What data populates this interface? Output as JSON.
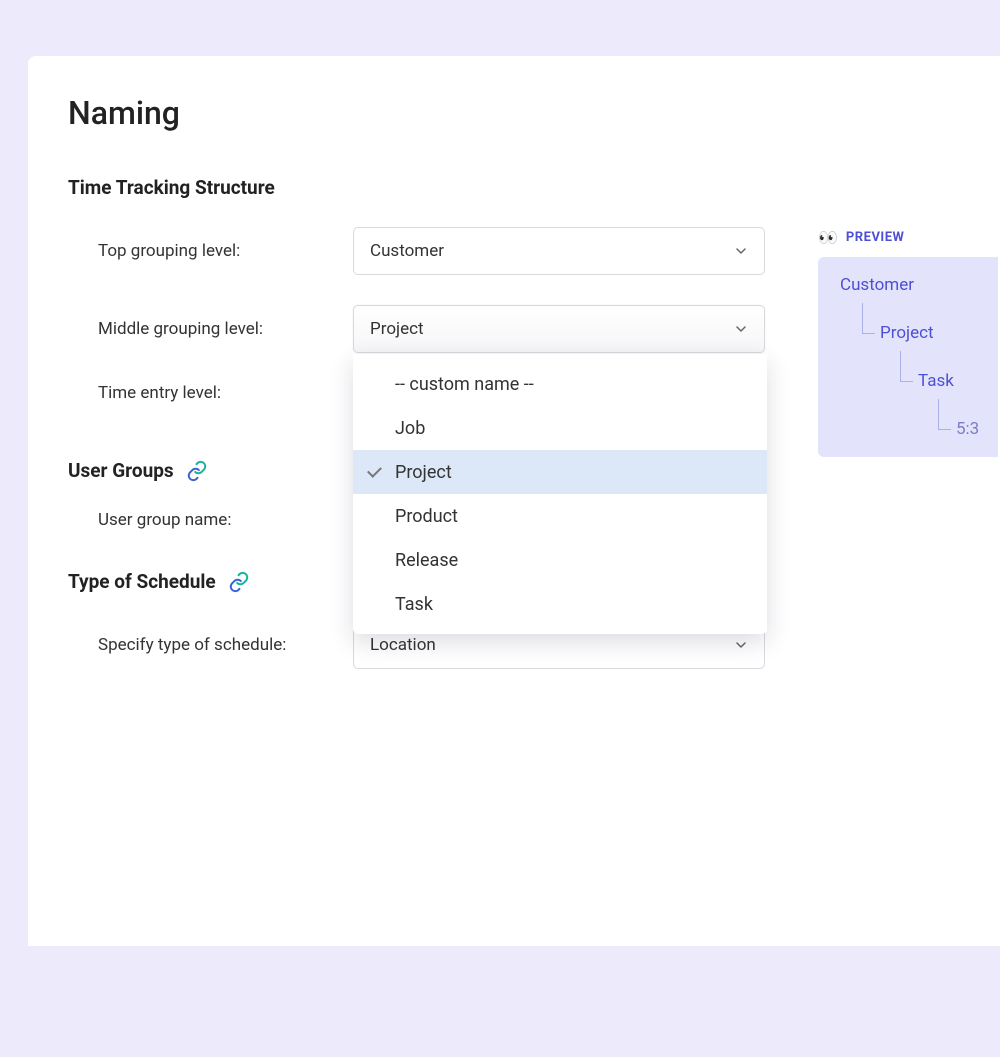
{
  "page": {
    "title": "Naming"
  },
  "sections": {
    "tracking": {
      "heading": "Time Tracking Structure"
    },
    "user_groups": {
      "heading": "User Groups"
    },
    "schedule": {
      "heading": "Type of Schedule"
    }
  },
  "fields": {
    "top_level": {
      "label": "Top grouping level:",
      "value": "Customer"
    },
    "middle_level": {
      "label": "Middle grouping level:",
      "value": "Project",
      "options": [
        "-- custom name --",
        "Job",
        "Project",
        "Product",
        "Release",
        "Task"
      ]
    },
    "entry_level": {
      "label": "Time entry level:"
    },
    "user_group_name": {
      "label": "User group name:"
    },
    "schedule_type": {
      "label": "Specify type of schedule:",
      "value": "Location"
    }
  },
  "preview": {
    "label": "PREVIEW",
    "eyes": "👀",
    "tree": [
      "Customer",
      "Project",
      "Task",
      "5:3"
    ]
  }
}
